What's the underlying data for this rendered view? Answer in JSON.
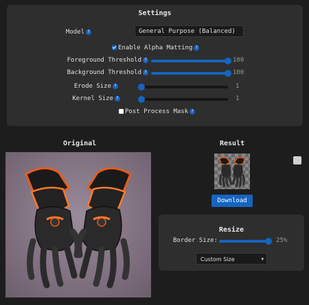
{
  "settings": {
    "title": "Settings",
    "model": {
      "label": "Model",
      "value": "General Purpose (Balanced)"
    },
    "alpha_matting": {
      "label": "Enable Alpha Matting",
      "checked": true
    },
    "sliders": [
      {
        "label": "Foreground Threshold",
        "value": "100",
        "fraction": 1.0
      },
      {
        "label": "Background Threshold",
        "value": "100",
        "fraction": 1.0
      },
      {
        "label": "Erode Size",
        "value": "1",
        "fraction": 0.0
      },
      {
        "label": "Kernel Size",
        "value": "1",
        "fraction": 0.0
      }
    ],
    "post_process": {
      "label": "Post Process Mask",
      "checked": false
    }
  },
  "original": {
    "heading": "Original"
  },
  "result": {
    "heading": "Result",
    "download_label": "Download"
  },
  "resize": {
    "title": "Resize",
    "border_label": "Border Size:",
    "border_value": "25%",
    "border_fraction": 0.95,
    "size_option": "Custom Size"
  },
  "colors": {
    "accent": "#1565c0",
    "panel": "#2e2e2e",
    "background": "#1d1d1d"
  }
}
